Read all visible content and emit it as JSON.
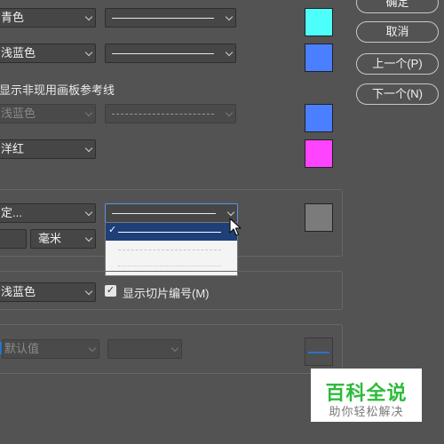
{
  "buttons": {
    "ok": "确定",
    "cancel": "取消",
    "prev": "上一个(P)",
    "next": "下一个(N)"
  },
  "guides": {
    "color": "青色",
    "swatch_color": "#4dfffa"
  },
  "smart_guides": {
    "color": "浅蓝色",
    "swatch_color": "#4a7fff"
  },
  "inactive_artboard": {
    "label": "显示非现用画板参考线",
    "color": "浅蓝色",
    "swatch_color": "#4a7fff"
  },
  "artboard_color": {
    "color": "洋红",
    "swatch_color": "#ff44ff"
  },
  "grid": {
    "color": "定...",
    "swatch_color": "#7b7b7b",
    "unit": "毫米",
    "line_style_options": [
      "solid",
      "dashed",
      "dotted"
    ],
    "selected_style": "solid"
  },
  "slices": {
    "color": "浅蓝色",
    "show_numbers_label": "显示切片编号(M)",
    "show_numbers_checked": true
  },
  "path": {
    "color": "默认值",
    "swatch_line_color": "#2c72c7"
  },
  "watermark": {
    "title": "百科全说",
    "subtitle": "助你轻松解决"
  }
}
